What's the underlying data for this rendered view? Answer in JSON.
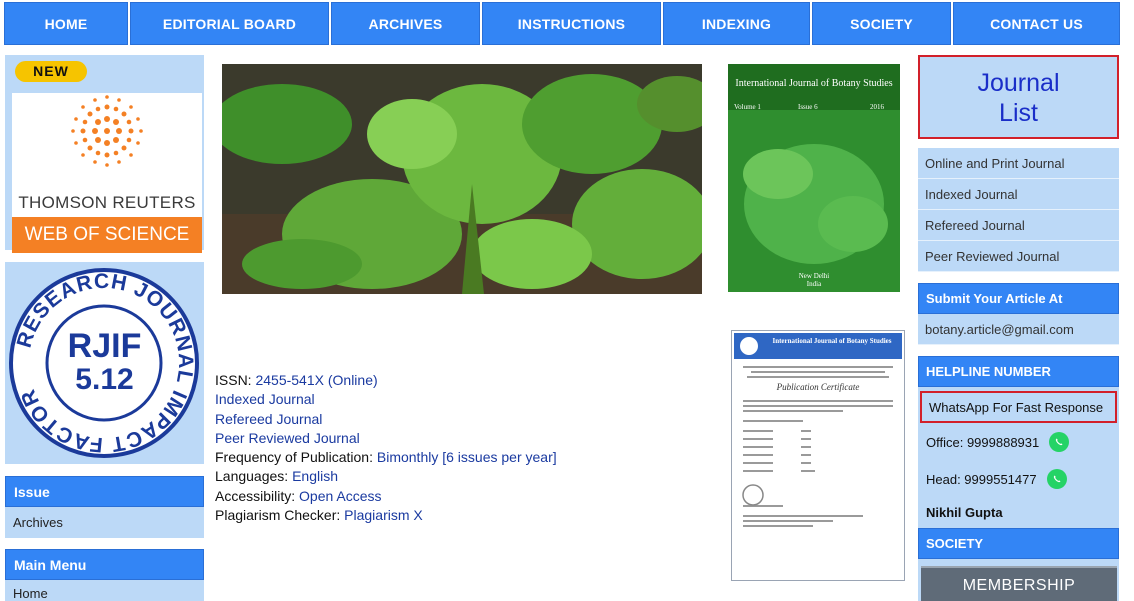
{
  "nav": {
    "items": [
      "HOME",
      "EDITORIAL BOARD",
      "ARCHIVES",
      "INSTRUCTIONS",
      "INDEXING",
      "SOCIETY",
      "CONTACT US"
    ]
  },
  "left": {
    "new_badge": "NEW",
    "thomson": "THOMSON REUTERS",
    "web_of_science": "WEB OF SCIENCE",
    "rjif_ring": "RESEARCH JOURNAL IMPACT FACTOR",
    "rjif_title": "RJIF",
    "rjif_value": "5.12",
    "issue_head": "Issue",
    "archives": "Archives",
    "main_menu_head": "Main Menu",
    "home": "Home"
  },
  "cover": {
    "title": "International Journal of Botany Studies",
    "volume": "Volume 1",
    "issue": "Issue 6",
    "year": "2016",
    "place": "New Delhi",
    "country": "India"
  },
  "certificate": {
    "title": "International Journal of Botany Studies",
    "subtitle": "Publication Certificate"
  },
  "info": {
    "issn_label": "ISSN: ",
    "issn_value": "2455-541X (Online)",
    "indexed": "Indexed Journal",
    "refereed": "Refereed Journal",
    "peer": "Peer Reviewed Journal",
    "freq_label": "Frequency of Publication: ",
    "freq_value": "Bimonthly [6 issues per year]",
    "lang_label": "Languages: ",
    "lang_value": "English",
    "access_label": "Accessibility: ",
    "access_value": "Open Access",
    "plag_label": "Plagiarism Checker: ",
    "plag_value": "Plagiarism X"
  },
  "right": {
    "journal_list_1": "Journal",
    "journal_list_2": "List",
    "links": [
      "Online and Print Journal",
      "Indexed Journal",
      "Refereed Journal",
      "Peer Reviewed Journal"
    ],
    "submit_head": "Submit Your Article At",
    "email": "botany.article@gmail.com",
    "helpline_head": "HELPLINE NUMBER",
    "whatsapp": "WhatsApp For Fast Response",
    "office": "Office: 9999888931",
    "head": "Head: 9999551477",
    "name": "Nikhil Gupta",
    "society_head": "SOCIETY",
    "membership": "MEMBERSHIP"
  },
  "colors": {
    "nav_blue": "#3385f5",
    "panel_blue": "#bcd9f7",
    "highlight_red": "#d2202a",
    "link_blue": "#1a3aa0",
    "whatsapp_green": "#25d366",
    "wos_orange": "#f48024"
  }
}
